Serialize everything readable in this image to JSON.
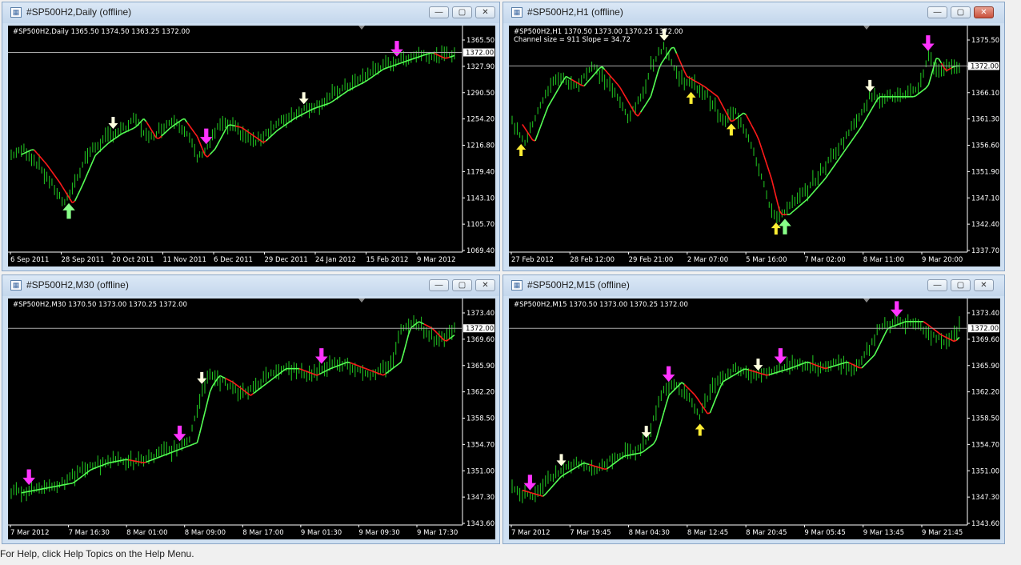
{
  "status_text": "For Help, click Help Topics on the Help Menu.",
  "colors": {
    "bull": "#22cc22",
    "bear": "#ff1a1a",
    "arrow_magenta": "#ff33ff",
    "arrow_white": "#ffffe0",
    "arrow_yellow": "#ffee33",
    "arrow_green": "#88ff88"
  },
  "windows": [
    {
      "title": "#SP500H2,Daily (offline)",
      "header": "#SP500H2,Daily  1365.50 1374.50 1363.25 1372.00",
      "header2": "",
      "current_price": "1372.00",
      "y_ticks": [
        "1365.50",
        "1327.90",
        "1290.50",
        "1254.20",
        "1216.80",
        "1179.40",
        "1143.10",
        "1105.70",
        "1069.40"
      ],
      "x_ticks": [
        "6 Sep 2011",
        "28 Sep 2011",
        "20 Oct 2011",
        "11 Nov 2011",
        "6 Dec 2011",
        "29 Dec 2011",
        "24 Jan 2012",
        "15 Feb 2012",
        "9 Mar 2012"
      ]
    },
    {
      "title": "#SP500H2,H1 (offline)",
      "header": "#SP500H2,H1  1370.50 1373.00 1370.25 1372.00",
      "header2": "Channel size = 911 Slope = 34.72",
      "current_price": "1372.00",
      "y_ticks": [
        "1375.50",
        "1370.80",
        "1366.10",
        "1361.30",
        "1356.60",
        "1351.90",
        "1347.10",
        "1342.40",
        "1337.70"
      ],
      "x_ticks": [
        "27 Feb 2012",
        "28 Feb 12:00",
        "29 Feb 21:00",
        "2 Mar 07:00",
        "5 Mar 16:00",
        "7 Mar 02:00",
        "8 Mar 11:00",
        "9 Mar 20:00"
      ]
    },
    {
      "title": "#SP500H2,M30 (offline)",
      "header": "#SP500H2,M30  1370.50 1373.00 1370.25 1372.00",
      "header2": "",
      "current_price": "1372.00",
      "y_ticks": [
        "1373.40",
        "1369.60",
        "1365.90",
        "1362.20",
        "1358.50",
        "1354.70",
        "1351.00",
        "1347.30",
        "1343.60"
      ],
      "x_ticks": [
        "7 Mar 2012",
        "7 Mar 16:30",
        "8 Mar 01:00",
        "8 Mar 09:00",
        "8 Mar 17:00",
        "9 Mar 01:30",
        "9 Mar 09:30",
        "9 Mar 17:30"
      ]
    },
    {
      "title": "#SP500H2,M15 (offline)",
      "header": "#SP500H2,M15  1370.50 1373.00 1370.25 1372.00",
      "header2": "",
      "current_price": "1372.00",
      "y_ticks": [
        "1373.40",
        "1369.60",
        "1365.90",
        "1362.20",
        "1358.50",
        "1354.70",
        "1351.00",
        "1347.30",
        "1343.60"
      ],
      "x_ticks": [
        "7 Mar 2012",
        "7 Mar 19:45",
        "8 Mar 04:30",
        "8 Mar 12:45",
        "8 Mar 20:45",
        "9 Mar 05:45",
        "9 Mar 13:45",
        "9 Mar 21:45"
      ]
    }
  ],
  "chart_data": [
    {
      "type": "bar",
      "name": "Daily",
      "ylim": [
        1050,
        1400
      ],
      "price_points": [
        [
          0,
          1205
        ],
        [
          0.03,
          1215
        ],
        [
          0.06,
          1190
        ],
        [
          0.09,
          1160
        ],
        [
          0.12,
          1125
        ],
        [
          0.14,
          1155
        ],
        [
          0.17,
          1205
        ],
        [
          0.2,
          1225
        ],
        [
          0.23,
          1240
        ],
        [
          0.26,
          1250
        ],
        [
          0.28,
          1265
        ],
        [
          0.31,
          1230
        ],
        [
          0.34,
          1250
        ],
        [
          0.37,
          1265
        ],
        [
          0.4,
          1235
        ],
        [
          0.42,
          1200
        ],
        [
          0.44,
          1215
        ],
        [
          0.47,
          1255
        ],
        [
          0.5,
          1250
        ],
        [
          0.53,
          1235
        ],
        [
          0.55,
          1225
        ],
        [
          0.58,
          1245
        ],
        [
          0.62,
          1265
        ],
        [
          0.66,
          1280
        ],
        [
          0.7,
          1290
        ],
        [
          0.74,
          1310
        ],
        [
          0.78,
          1325
        ],
        [
          0.82,
          1345
        ],
        [
          0.86,
          1355
        ],
        [
          0.9,
          1365
        ],
        [
          0.93,
          1372
        ],
        [
          0.96,
          1362
        ],
        [
          1,
          1372
        ]
      ],
      "arrows": [
        [
          0.13,
          "up",
          "arrow_green"
        ],
        [
          0.23,
          "down",
          "arrow_white"
        ],
        [
          0.44,
          "down",
          "arrow_magenta"
        ],
        [
          0.66,
          "down",
          "arrow_white"
        ],
        [
          0.87,
          "down",
          "arrow_magenta"
        ]
      ]
    },
    {
      "type": "bar",
      "name": "H1",
      "ylim": [
        1336,
        1378
      ],
      "price_points": [
        [
          0,
          1361
        ],
        [
          0.03,
          1357
        ],
        [
          0.06,
          1364
        ],
        [
          0.1,
          1370
        ],
        [
          0.14,
          1368
        ],
        [
          0.18,
          1372
        ],
        [
          0.22,
          1368
        ],
        [
          0.26,
          1362
        ],
        [
          0.29,
          1366
        ],
        [
          0.31,
          1372
        ],
        [
          0.34,
          1376
        ],
        [
          0.37,
          1370
        ],
        [
          0.41,
          1368
        ],
        [
          0.44,
          1366
        ],
        [
          0.47,
          1361
        ],
        [
          0.5,
          1363
        ],
        [
          0.53,
          1358
        ],
        [
          0.56,
          1350
        ],
        [
          0.58,
          1343
        ],
        [
          0.6,
          1343
        ],
        [
          0.64,
          1346
        ],
        [
          0.68,
          1350
        ],
        [
          0.72,
          1355
        ],
        [
          0.76,
          1360
        ],
        [
          0.8,
          1366
        ],
        [
          0.84,
          1366
        ],
        [
          0.88,
          1366
        ],
        [
          0.91,
          1368
        ],
        [
          0.93,
          1374
        ],
        [
          0.95,
          1371
        ],
        [
          0.97,
          1372
        ]
      ],
      "arrows": [
        [
          0.02,
          "up",
          "arrow_yellow"
        ],
        [
          0.34,
          "down",
          "arrow_white"
        ],
        [
          0.4,
          "up",
          "arrow_yellow"
        ],
        [
          0.49,
          "up",
          "arrow_yellow"
        ],
        [
          0.59,
          "up",
          "arrow_yellow"
        ],
        [
          0.61,
          "up",
          "arrow_green"
        ],
        [
          0.8,
          "down",
          "arrow_white"
        ],
        [
          0.93,
          "down",
          "arrow_magenta"
        ]
      ]
    },
    {
      "type": "bar",
      "name": "M30",
      "ylim": [
        1343,
        1375
      ],
      "price_points": [
        [
          0,
          1347.5
        ],
        [
          0.04,
          1348
        ],
        [
          0.08,
          1348.5
        ],
        [
          0.12,
          1349
        ],
        [
          0.16,
          1351
        ],
        [
          0.2,
          1352
        ],
        [
          0.24,
          1352.5
        ],
        [
          0.28,
          1352
        ],
        [
          0.32,
          1353
        ],
        [
          0.36,
          1354
        ],
        [
          0.4,
          1355
        ],
        [
          0.43,
          1363
        ],
        [
          0.45,
          1365
        ],
        [
          0.48,
          1364
        ],
        [
          0.52,
          1362
        ],
        [
          0.56,
          1364
        ],
        [
          0.6,
          1366
        ],
        [
          0.63,
          1366
        ],
        [
          0.67,
          1365
        ],
        [
          0.7,
          1366
        ],
        [
          0.74,
          1367
        ],
        [
          0.78,
          1366
        ],
        [
          0.82,
          1365
        ],
        [
          0.86,
          1367
        ],
        [
          0.88,
          1372
        ],
        [
          0.9,
          1373
        ],
        [
          0.93,
          1372
        ],
        [
          0.96,
          1370
        ],
        [
          1,
          1372
        ]
      ],
      "arrows": [
        [
          0.04,
          "down",
          "arrow_magenta"
        ],
        [
          0.38,
          "down",
          "arrow_magenta"
        ],
        [
          0.43,
          "down",
          "arrow_white"
        ],
        [
          0.7,
          "down",
          "arrow_magenta"
        ]
      ]
    },
    {
      "type": "bar",
      "name": "M15",
      "ylim": [
        1343,
        1375
      ],
      "price_points": [
        [
          0,
          1348
        ],
        [
          0.05,
          1347
        ],
        [
          0.09,
          1350
        ],
        [
          0.14,
          1352
        ],
        [
          0.19,
          1351
        ],
        [
          0.23,
          1353
        ],
        [
          0.27,
          1353.5
        ],
        [
          0.3,
          1355
        ],
        [
          0.33,
          1362
        ],
        [
          0.36,
          1364
        ],
        [
          0.39,
          1362
        ],
        [
          0.42,
          1359
        ],
        [
          0.45,
          1364
        ],
        [
          0.5,
          1366
        ],
        [
          0.55,
          1365
        ],
        [
          0.6,
          1366
        ],
        [
          0.64,
          1367
        ],
        [
          0.68,
          1366
        ],
        [
          0.73,
          1367
        ],
        [
          0.76,
          1366
        ],
        [
          0.79,
          1368
        ],
        [
          0.82,
          1372
        ],
        [
          0.86,
          1373
        ],
        [
          0.9,
          1373
        ],
        [
          0.94,
          1371
        ],
        [
          0.97,
          1370
        ],
        [
          1,
          1372
        ]
      ],
      "arrows": [
        [
          0.04,
          "down",
          "arrow_magenta"
        ],
        [
          0.11,
          "down",
          "arrow_white"
        ],
        [
          0.3,
          "down",
          "arrow_white"
        ],
        [
          0.35,
          "down",
          "arrow_magenta"
        ],
        [
          0.42,
          "up",
          "arrow_yellow"
        ],
        [
          0.55,
          "down",
          "arrow_white"
        ],
        [
          0.6,
          "down",
          "arrow_magenta"
        ],
        [
          0.86,
          "down",
          "arrow_magenta"
        ]
      ]
    }
  ]
}
